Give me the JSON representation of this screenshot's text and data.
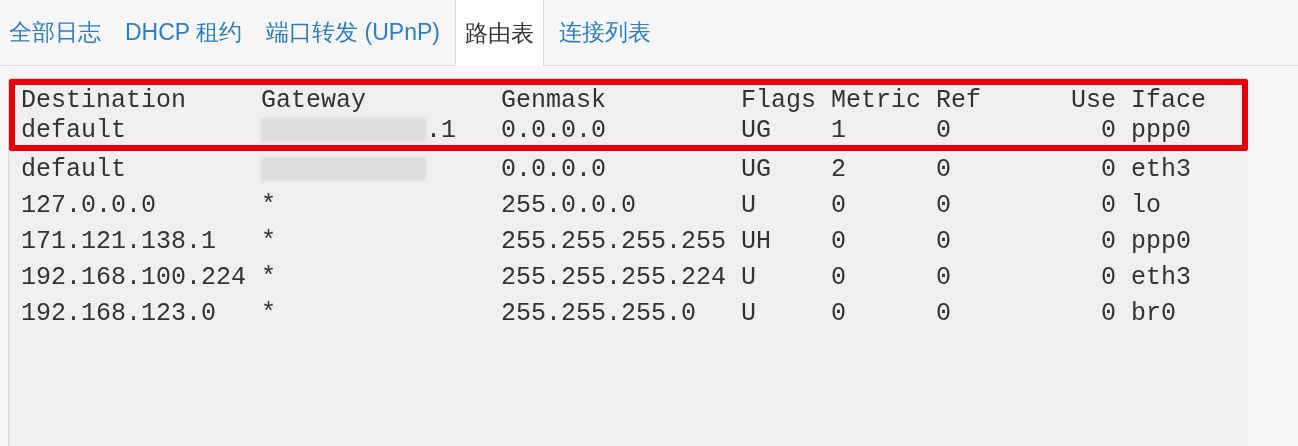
{
  "tabs": [
    {
      "label": "全部日志",
      "selected": false
    },
    {
      "label": "DHCP 租约",
      "selected": false
    },
    {
      "label": "端口转发 (UPnP)",
      "selected": false
    },
    {
      "label": "路由表",
      "selected": true
    },
    {
      "label": "连接列表",
      "selected": false
    }
  ],
  "routing_table": {
    "columns": [
      "Destination",
      "Gateway",
      "Genmask",
      "Flags",
      "Metric",
      "Ref",
      "Use",
      "Iface"
    ],
    "header_highlighted": true,
    "rows": [
      {
        "highlighted": true,
        "destination": "default",
        "gateway": ".1",
        "gateway_redacted": true,
        "genmask": "0.0.0.0",
        "flags": "UG",
        "metric": "1",
        "ref": "0",
        "use": "0",
        "iface": "ppp0"
      },
      {
        "highlighted": false,
        "destination": "default",
        "gateway_redacted": true,
        "genmask": "0.0.0.0",
        "flags": "UG",
        "metric": "2",
        "ref": "0",
        "use": "0",
        "iface": "eth3"
      },
      {
        "highlighted": false,
        "destination": "127.0.0.0",
        "gateway": "*",
        "gateway_redacted": false,
        "genmask": "255.0.0.0",
        "flags": "U",
        "metric": "0",
        "ref": "0",
        "use": "0",
        "iface": "lo"
      },
      {
        "highlighted": false,
        "destination": "171.121.138.1",
        "gateway": "*",
        "gateway_redacted": false,
        "genmask": "255.255.255.255",
        "flags": "UH",
        "metric": "0",
        "ref": "0",
        "use": "0",
        "iface": "ppp0"
      },
      {
        "highlighted": false,
        "destination": "192.168.100.224",
        "gateway": "*",
        "gateway_redacted": false,
        "genmask": "255.255.255.224",
        "flags": "U",
        "metric": "0",
        "ref": "0",
        "use": "0",
        "iface": "eth3"
      },
      {
        "highlighted": false,
        "destination": "192.168.123.0",
        "gateway": "*",
        "gateway_redacted": false,
        "genmask": "255.255.255.0",
        "flags": "U",
        "metric": "0",
        "ref": "0",
        "use": "0",
        "iface": "br0"
      }
    ]
  }
}
